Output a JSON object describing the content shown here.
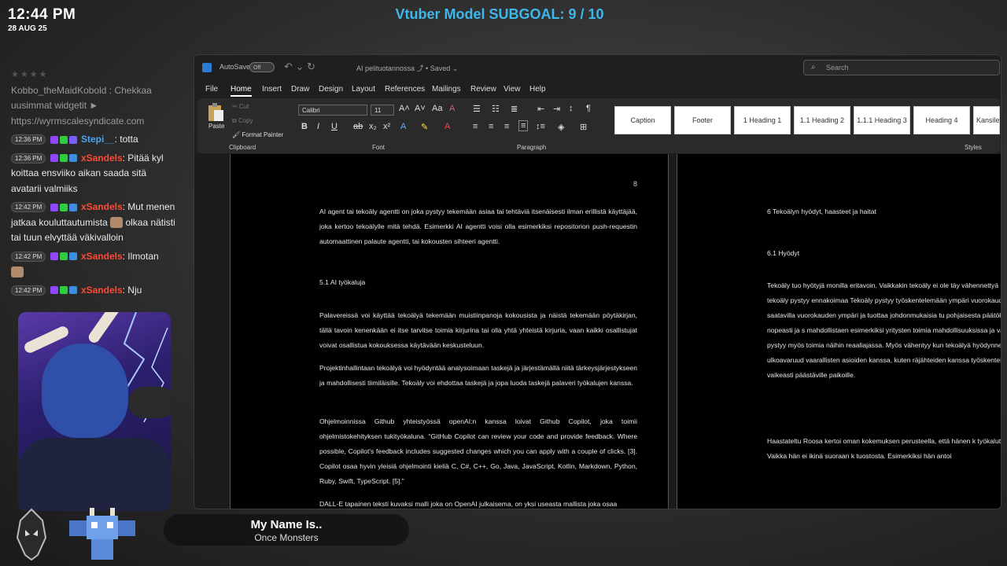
{
  "clock": {
    "time": "12:44 PM",
    "date": "28 AUG 25"
  },
  "subgoal": "Vtuber Model SUBGOAL: 9 / 10",
  "chat": {
    "first": {
      "user": "Kobbo_theMaidKobold",
      "text": ": Chekkaa uusimmat widgetit ► https://wyrmscalesyndicate.com"
    },
    "messages": [
      {
        "time": "12:36 PM",
        "user": "Stepi__",
        "text": ": totta"
      },
      {
        "time": "12:36 PM",
        "user": "xSandels",
        "text": ": Pitää kyl koittaa ensviiko aikan saada sitä avatarii valmiiks"
      },
      {
        "time": "12:42 PM",
        "user": "xSandels",
        "text": ": Mut menen jatkaa kouluttautumista",
        "text2": "olkaa nätisti tai tuun elvyttää väkivalloin"
      },
      {
        "time": "12:42 PM",
        "user": "xSandels",
        "text": ": Ilmotan"
      },
      {
        "time": "12:42 PM",
        "user": "xSandels",
        "text": ": Nju"
      }
    ]
  },
  "now_playing": {
    "title": "My Name Is..",
    "artist": "Once Monsters"
  },
  "word": {
    "autosave": "AutoSave",
    "toggle": "Off",
    "doc_title": "AI pelituotannossa ⤴ • Saved ⌄",
    "search_placeholder": "Search",
    "menu": [
      "File",
      "Home",
      "Insert",
      "Draw",
      "Design",
      "Layout",
      "References",
      "Mailings",
      "Review",
      "View",
      "Help"
    ],
    "ribbon": {
      "paste": "Paste",
      "cut": "Cut",
      "copy": "Copy",
      "format_painter": "Format Painter",
      "clipboard": "Clipboard",
      "font_name": "Calibri",
      "font_size": "11",
      "font": "Font",
      "paragraph": "Paragraph",
      "styles": "Styles",
      "style_items": [
        "Caption",
        "Footer",
        "1  Heading 1",
        "1.1  Heading 2",
        "1.1.1  Heading 3",
        "Heading 4",
        "Kansilehti"
      ]
    },
    "page1": {
      "number": "8",
      "p1": "AI agent tai tekoäly agentti on joka pystyy tekemään asiaa tai tehtäviä itsenäisesti ilman erillistä käyttäjää, joka kertoo tekoälylle mitä tehdä. Esimerkki AI agentti voisi olla esimerkiksi repositorion push-requestin automaattinen palaute agentti, tai kokousten sihteeri agentti.",
      "heading": "5.1      AI työkaluja",
      "p2": "Palavereissä voi käyttää tekoälyä tekemään muistiinpanoja kokousista ja näistä tekemään pöytäkirjan, tällä tavoin kenenkään ei itse tarvitse toimia kirjurina tai olla yhtä yhteistä kirjuria, vaan kaikki osallistujat voivat osallistua kokouksessa käytävään keskusteluun.",
      "p3": "Projektinhallintaan tekoälyä voi hyödyntää analysoimaan taskejä ja järjestämällä niitä tärkeysjärjestykseen ja mahdollisesti tiimiläisille. Tekoäly voi ehdottaa taskejä ja jopa luoda taskejä palaveri työkalujen kanssa.",
      "p4": "Ohjelmoinnissa Github yhteistyössä openAI:n kanssa loivat Github Copilot, joka toimii ohjelmistokehityksen tukityökaluna. “GitHub Copilot can review your code and provide feedback. Where possible, Copilot's feedback includes suggested changes which you can apply with a couple of clicks. [3]. Copilot osaa hyvin yleisiä ohjelmointi kieliä C, C#, C++, Go, Java, JavaScript, Kotlin, Markdown, Python, Ruby, Swift, TypeScript. [5].”",
      "p5": "DALL-E tapainen teksti kuvaksi malli joka on OpenAI julkaisema, on yksi useasta mallista joka osaa"
    },
    "page2": {
      "h1": "6      Tekoälyn hyödyt, haasteet ja haitat",
      "h2": "6.1      Hyödyt",
      "p1": "Tekoäly tuo hyötyjä monilla eritavoin. Vaikkakin tekoäly ei ole täy vähennettyä ihmisen tuottamia virheitä, tekoäly pystyy ennakoimaa Tekoäly pystyy työskentelemään ympäri vuorokauden toistuvasti ole tekoäly on saatavilla vuorokauden ympäri ja tuottaa johdonmukaisia tu pohjaisesta päätöksistä tekoäly pystyy toimimaan nopeasti ja s mahdollistaen esimerkiksi yritysten toimia mahdollisuuksissa ja vastata automatisoitu tekoäly pystyy myös toimia näihin reaaliajassa. Myös vähentyy kun tekoälyä hyödynnetään merensyvyyksissä tai ulkoavaruud vaarallisten asioiden kanssa, kuten räjähteiden kanssa työskentely käytetty jo pitkään ihmisille vaikeasti päästäville paikoille.",
      "p2": "Haastateltu Roosa kertoi oman kokemuksen perusteella, että hänen k työkalut ovat auttaneet huomattavasti. Vaikka hän ei ikinä suoraan k tuostosta. Esimerkiksi hän antoi"
    }
  }
}
